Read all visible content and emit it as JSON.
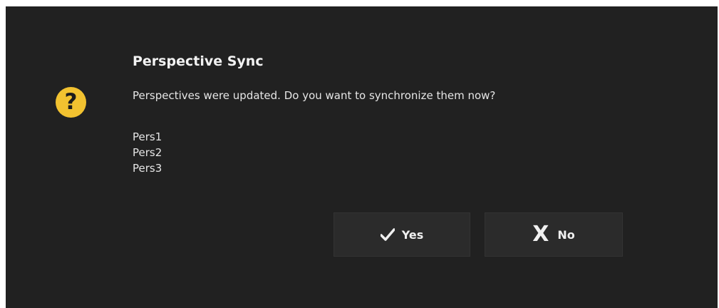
{
  "dialog": {
    "title": "Perspective Sync",
    "message": "Perspectives were updated. Do you want to synchronize them now?",
    "icon": "question-icon",
    "icon_glyph": "?",
    "perspectives": [
      "Pers1",
      "Pers2",
      "Pers3"
    ],
    "buttons": {
      "yes_label": "Yes",
      "yes_icon": "checkmark-icon",
      "no_label": "No",
      "no_icon": "x-icon",
      "no_glyph": "X"
    },
    "colors": {
      "background": "#212121",
      "icon_accent": "#f2c230",
      "button_bg": "#2b2b2b",
      "text": "#e6e6e6"
    }
  }
}
